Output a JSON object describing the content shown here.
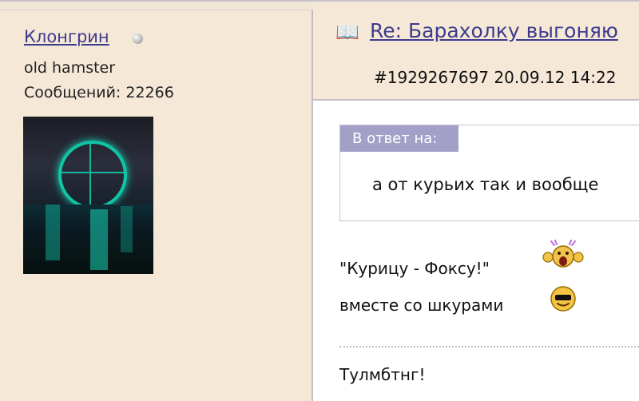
{
  "author": {
    "name": "Клонгрин",
    "rank": "old hamster",
    "messages_label": "Сообщений:",
    "messages_count": "22266",
    "status": "offline"
  },
  "avatar": {
    "description": "london-eye-avatar"
  },
  "post": {
    "icon_name": "book-icon",
    "title": "Re: Барахолку выгоняю",
    "id": "#1929267697",
    "date": "20.09.12",
    "time": "14:22"
  },
  "quote": {
    "label": "В ответ на:",
    "text": "а от курьих так и вообще"
  },
  "message": {
    "line1": "\"Курицу - Фоксу!\"",
    "line2": "вместе со шкурами",
    "emoji1": "screaming-face-emoji",
    "emoji2": "sunglasses-face-emoji",
    "signature": "Тулмбтнг!"
  },
  "colors": {
    "background": "#f5e8d6",
    "link": "#3d3b8e",
    "quote_header": "#a3a0c8",
    "border": "#c4bccb"
  }
}
